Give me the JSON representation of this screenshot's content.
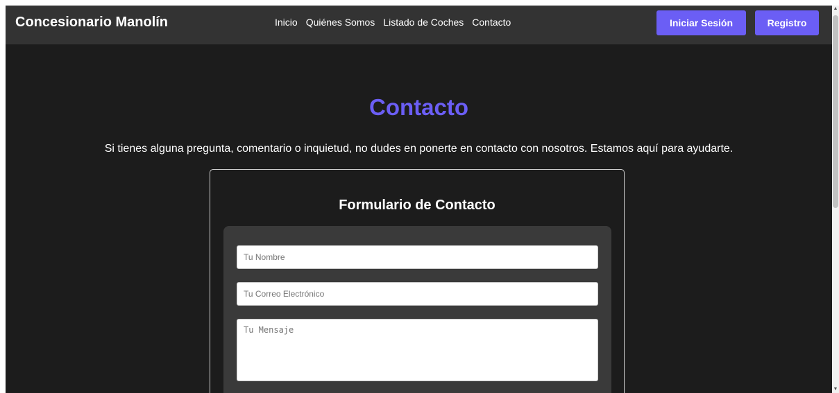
{
  "navbar": {
    "brand": "Concesionario Manolín",
    "links": [
      "Inicio",
      "Quiénes Somos",
      "Listado de Coches",
      "Contacto"
    ],
    "login_label": "Iniciar Sesión",
    "register_label": "Registro"
  },
  "main": {
    "title": "Contacto",
    "intro": "Si tienes alguna pregunta, comentario o inquietud, no dudes en ponerte en contacto con nosotros. Estamos aquí para ayudarte."
  },
  "form": {
    "title": "Formulario de Contacto",
    "name_placeholder": "Tu Nombre",
    "name_value": "",
    "email_placeholder": "Tu Correo Electrónico",
    "email_value": "",
    "message_placeholder": "Tu Mensaje",
    "message_value": ""
  },
  "colors": {
    "accent": "#6b5ef5",
    "background": "#1c1c1c",
    "navbar": "#333333",
    "form_panel": "#3a3a3a"
  },
  "icons": {
    "scroll_up": "caret-up-icon",
    "scroll_down": "caret-down-icon"
  }
}
